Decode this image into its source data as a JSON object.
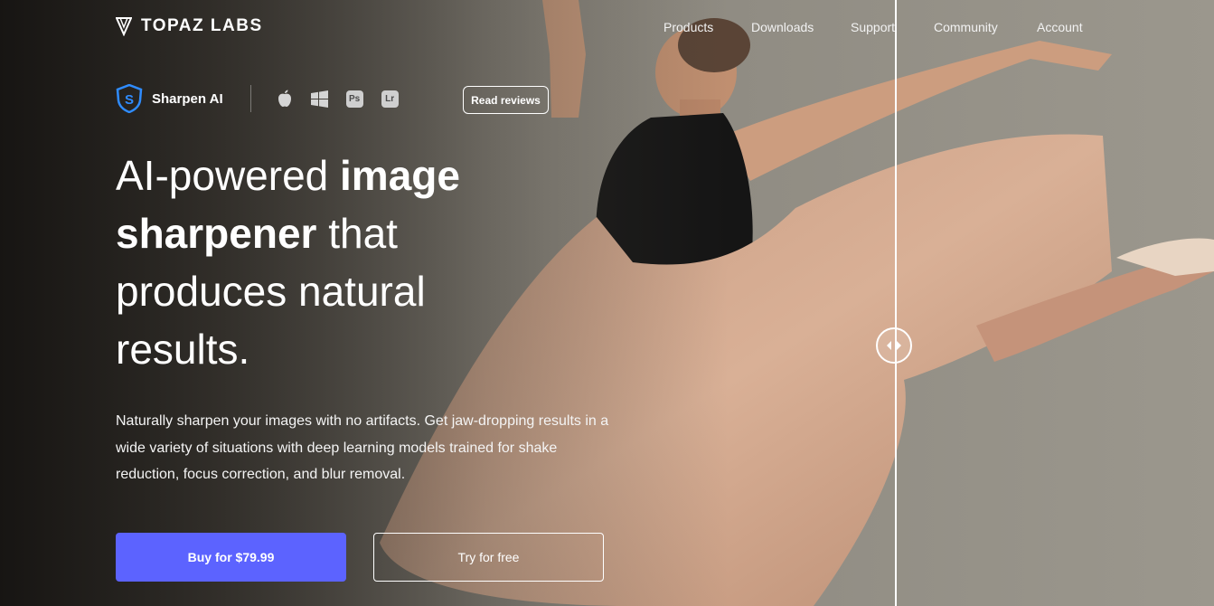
{
  "brand": {
    "name": "TOPAZ LABS"
  },
  "nav": {
    "items": [
      {
        "label": "Products"
      },
      {
        "label": "Downloads"
      },
      {
        "label": "Support"
      },
      {
        "label": "Community"
      },
      {
        "label": "Account"
      }
    ]
  },
  "product": {
    "name": "Sharpen AI",
    "icon": "sharpen-ai-shield-icon",
    "platforms": [
      {
        "icon": "apple-icon"
      },
      {
        "icon": "windows-icon"
      },
      {
        "label": "Ps"
      },
      {
        "label": "Lr"
      }
    ],
    "reviews_label": "Read reviews"
  },
  "hero": {
    "headline_part1": "AI-powered ",
    "headline_bold1": "image sharpener",
    "headline_part2": " that produces natural results.",
    "description": "Naturally sharpen your images with no artifacts. Get jaw-dropping results in a wide variety of situations with deep learning models trained for shake reduction, focus correction, and blur removal."
  },
  "cta": {
    "buy_label": "Buy for $79.99",
    "try_label": "Try for free"
  },
  "colors": {
    "accent": "#5c63ff",
    "logo_blue": "#2f8cff"
  }
}
